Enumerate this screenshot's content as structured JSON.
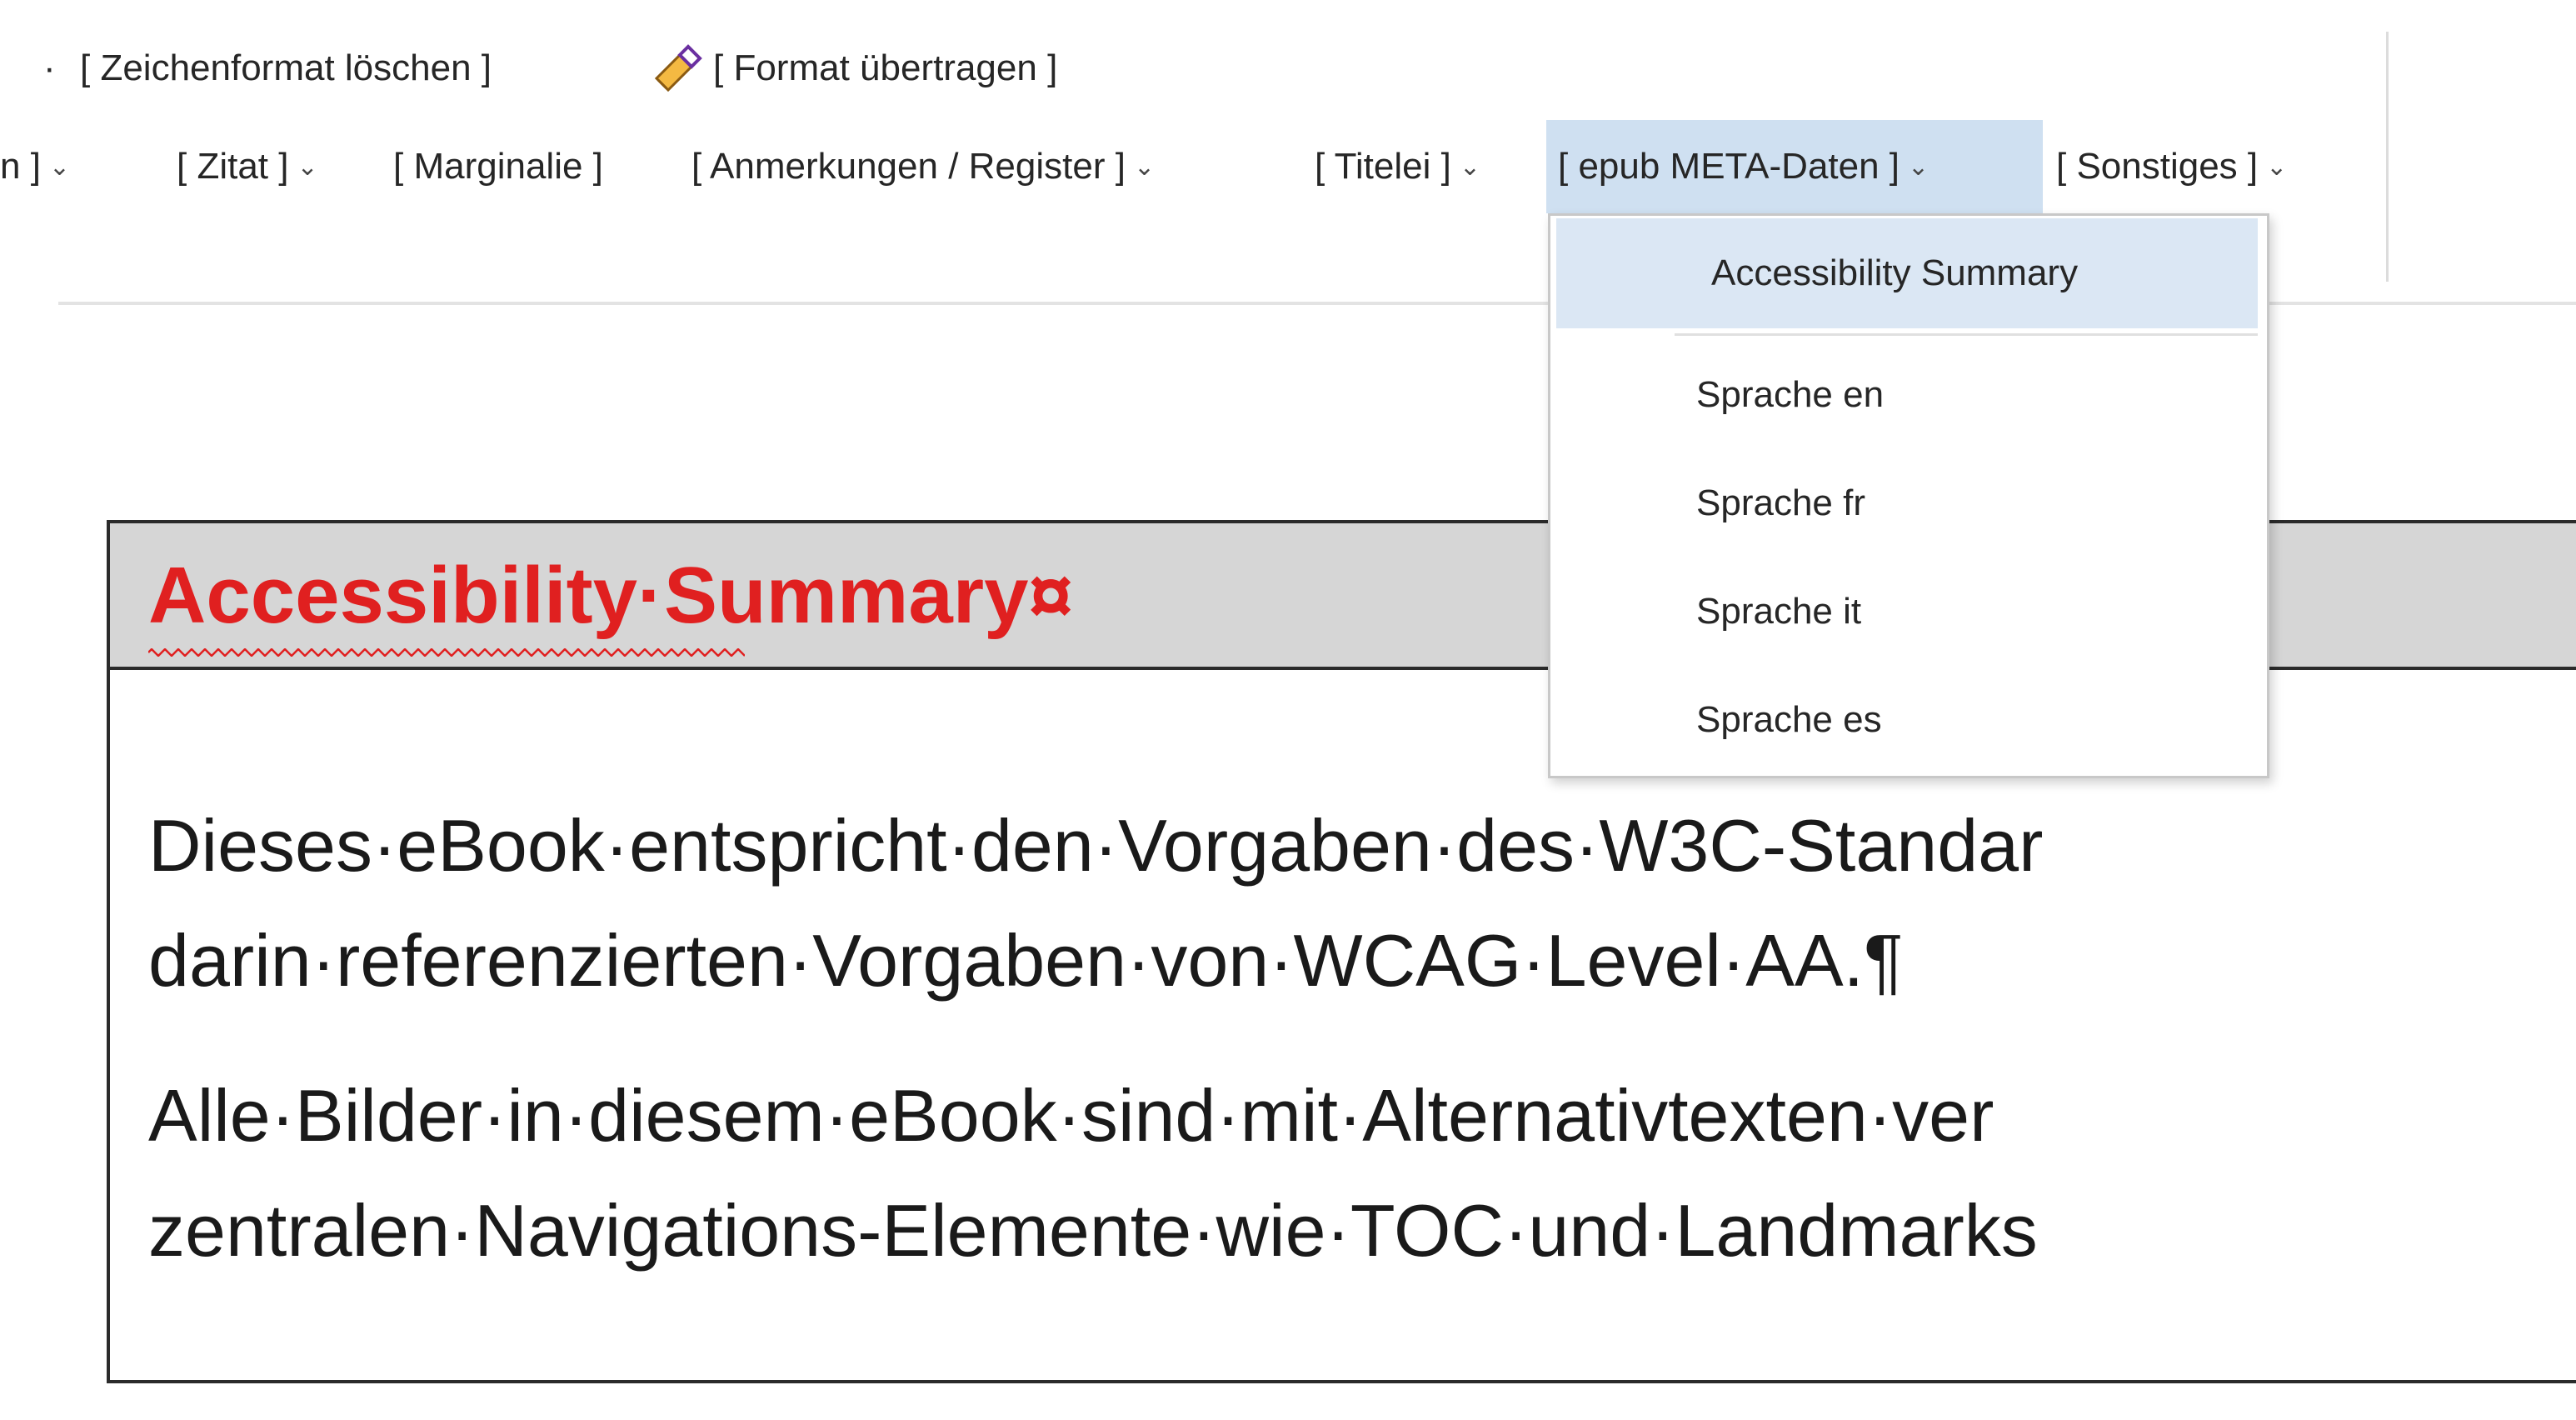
{
  "ribbon": {
    "row1": {
      "clear_format": "[ Zeichenformat löschen ]",
      "format_painter": "[ Format übertragen ]"
    },
    "row2": {
      "partial_label": "n ]",
      "zitat": "[ Zitat ]",
      "marginalie": "[ Marginalie ]",
      "anmerkungen": "[ Anmerkungen / Register ]",
      "titelei": "[ Titelei ]",
      "epub_meta": "[ epub META-Daten ]",
      "sonstiges": "[ Sonstiges ]"
    },
    "chevron": "⌄",
    "dot_bullet": "·"
  },
  "dropdown": {
    "items": [
      "Accessibility Summary",
      "Sprache en",
      "Sprache fr",
      "Sprache it",
      "Sprache es"
    ]
  },
  "document": {
    "title": "Accessibility·Summary¤",
    "lines": [
      "Dieses·eBook·entspricht·den·Vorgaben·des·W3C-Standar",
      "darin·referenzierten·Vorgaben·von·WCAG·Level·AA.¶",
      "Alle·Bilder·in·diesem·eBook·sind·mit·Alternativtexten·ver",
      "zentralen·Navigations-Elemente·wie·TOC·und·Landmarks"
    ]
  },
  "colors": {
    "title_red": "#e02020",
    "header_gray": "#d6d6d6",
    "active_blue": "#cfe0f1",
    "menu_highlight": "#dbe7f4"
  }
}
